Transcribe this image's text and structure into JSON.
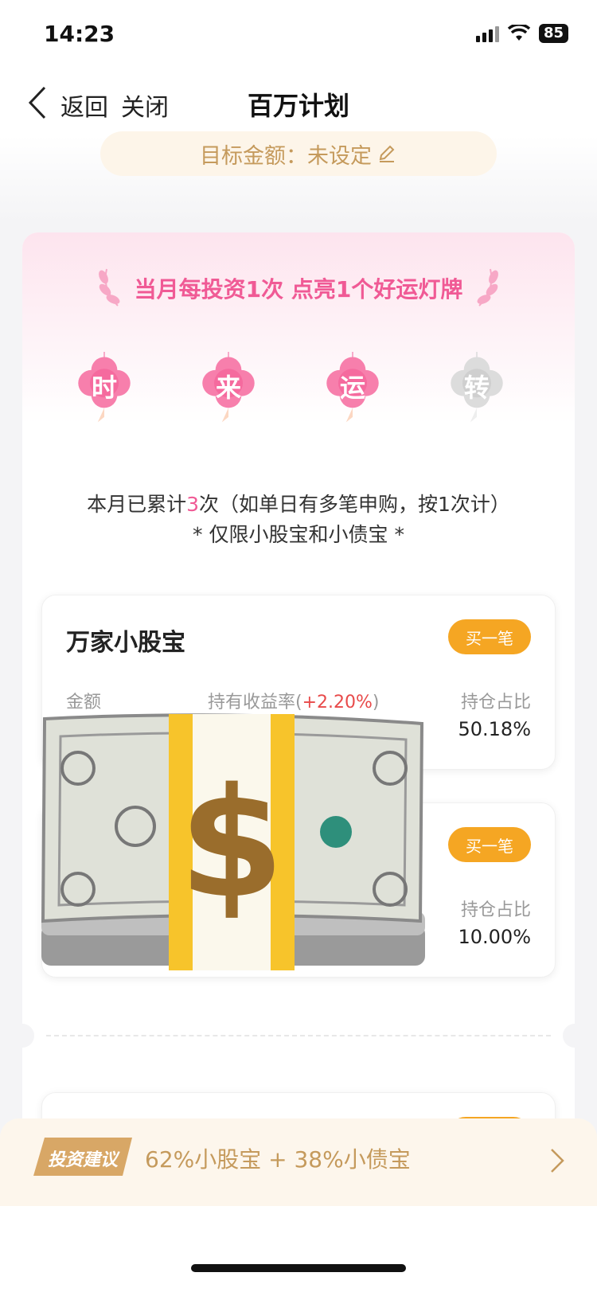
{
  "status_bar": {
    "time": "14:23",
    "battery": "85"
  },
  "nav": {
    "back_label": "返回",
    "close_label": "关闭",
    "title": "百万计划"
  },
  "target": {
    "label": "目标金额：未设定"
  },
  "campaign": {
    "slogan": "当月每投资1次 点亮1个好运灯牌",
    "lamps": [
      {
        "char": "时",
        "lit": true
      },
      {
        "char": "来",
        "lit": true
      },
      {
        "char": "运",
        "lit": true
      },
      {
        "char": "转",
        "lit": false
      }
    ],
    "count_prefix": "本月已累计",
    "count_value": "3",
    "count_suffix": "次（如单日有多笔申购，按1次计）",
    "limit_note": "* 仅限小股宝和小债宝 *"
  },
  "funds": [
    {
      "name": "万家小股宝",
      "buy_label": "买一笔",
      "amount_label": "金额",
      "rate_label": "持有收益率(",
      "rate_value": "+2.20%",
      "rate_close": ")",
      "share_label": "持仓占比",
      "share_value": "50.18%"
    },
    {
      "buy_label": "买一笔",
      "share_label": "持仓占比",
      "share_value": "10.00%"
    }
  ],
  "advice": {
    "tag": "投资建议",
    "text": "62%小股宝 + 38%小债宝"
  },
  "colors": {
    "accent_pink": "#f05a95",
    "accent_orange": "#f5a623",
    "gold_text": "#c59a5c",
    "gain_red": "#e84a4a"
  }
}
